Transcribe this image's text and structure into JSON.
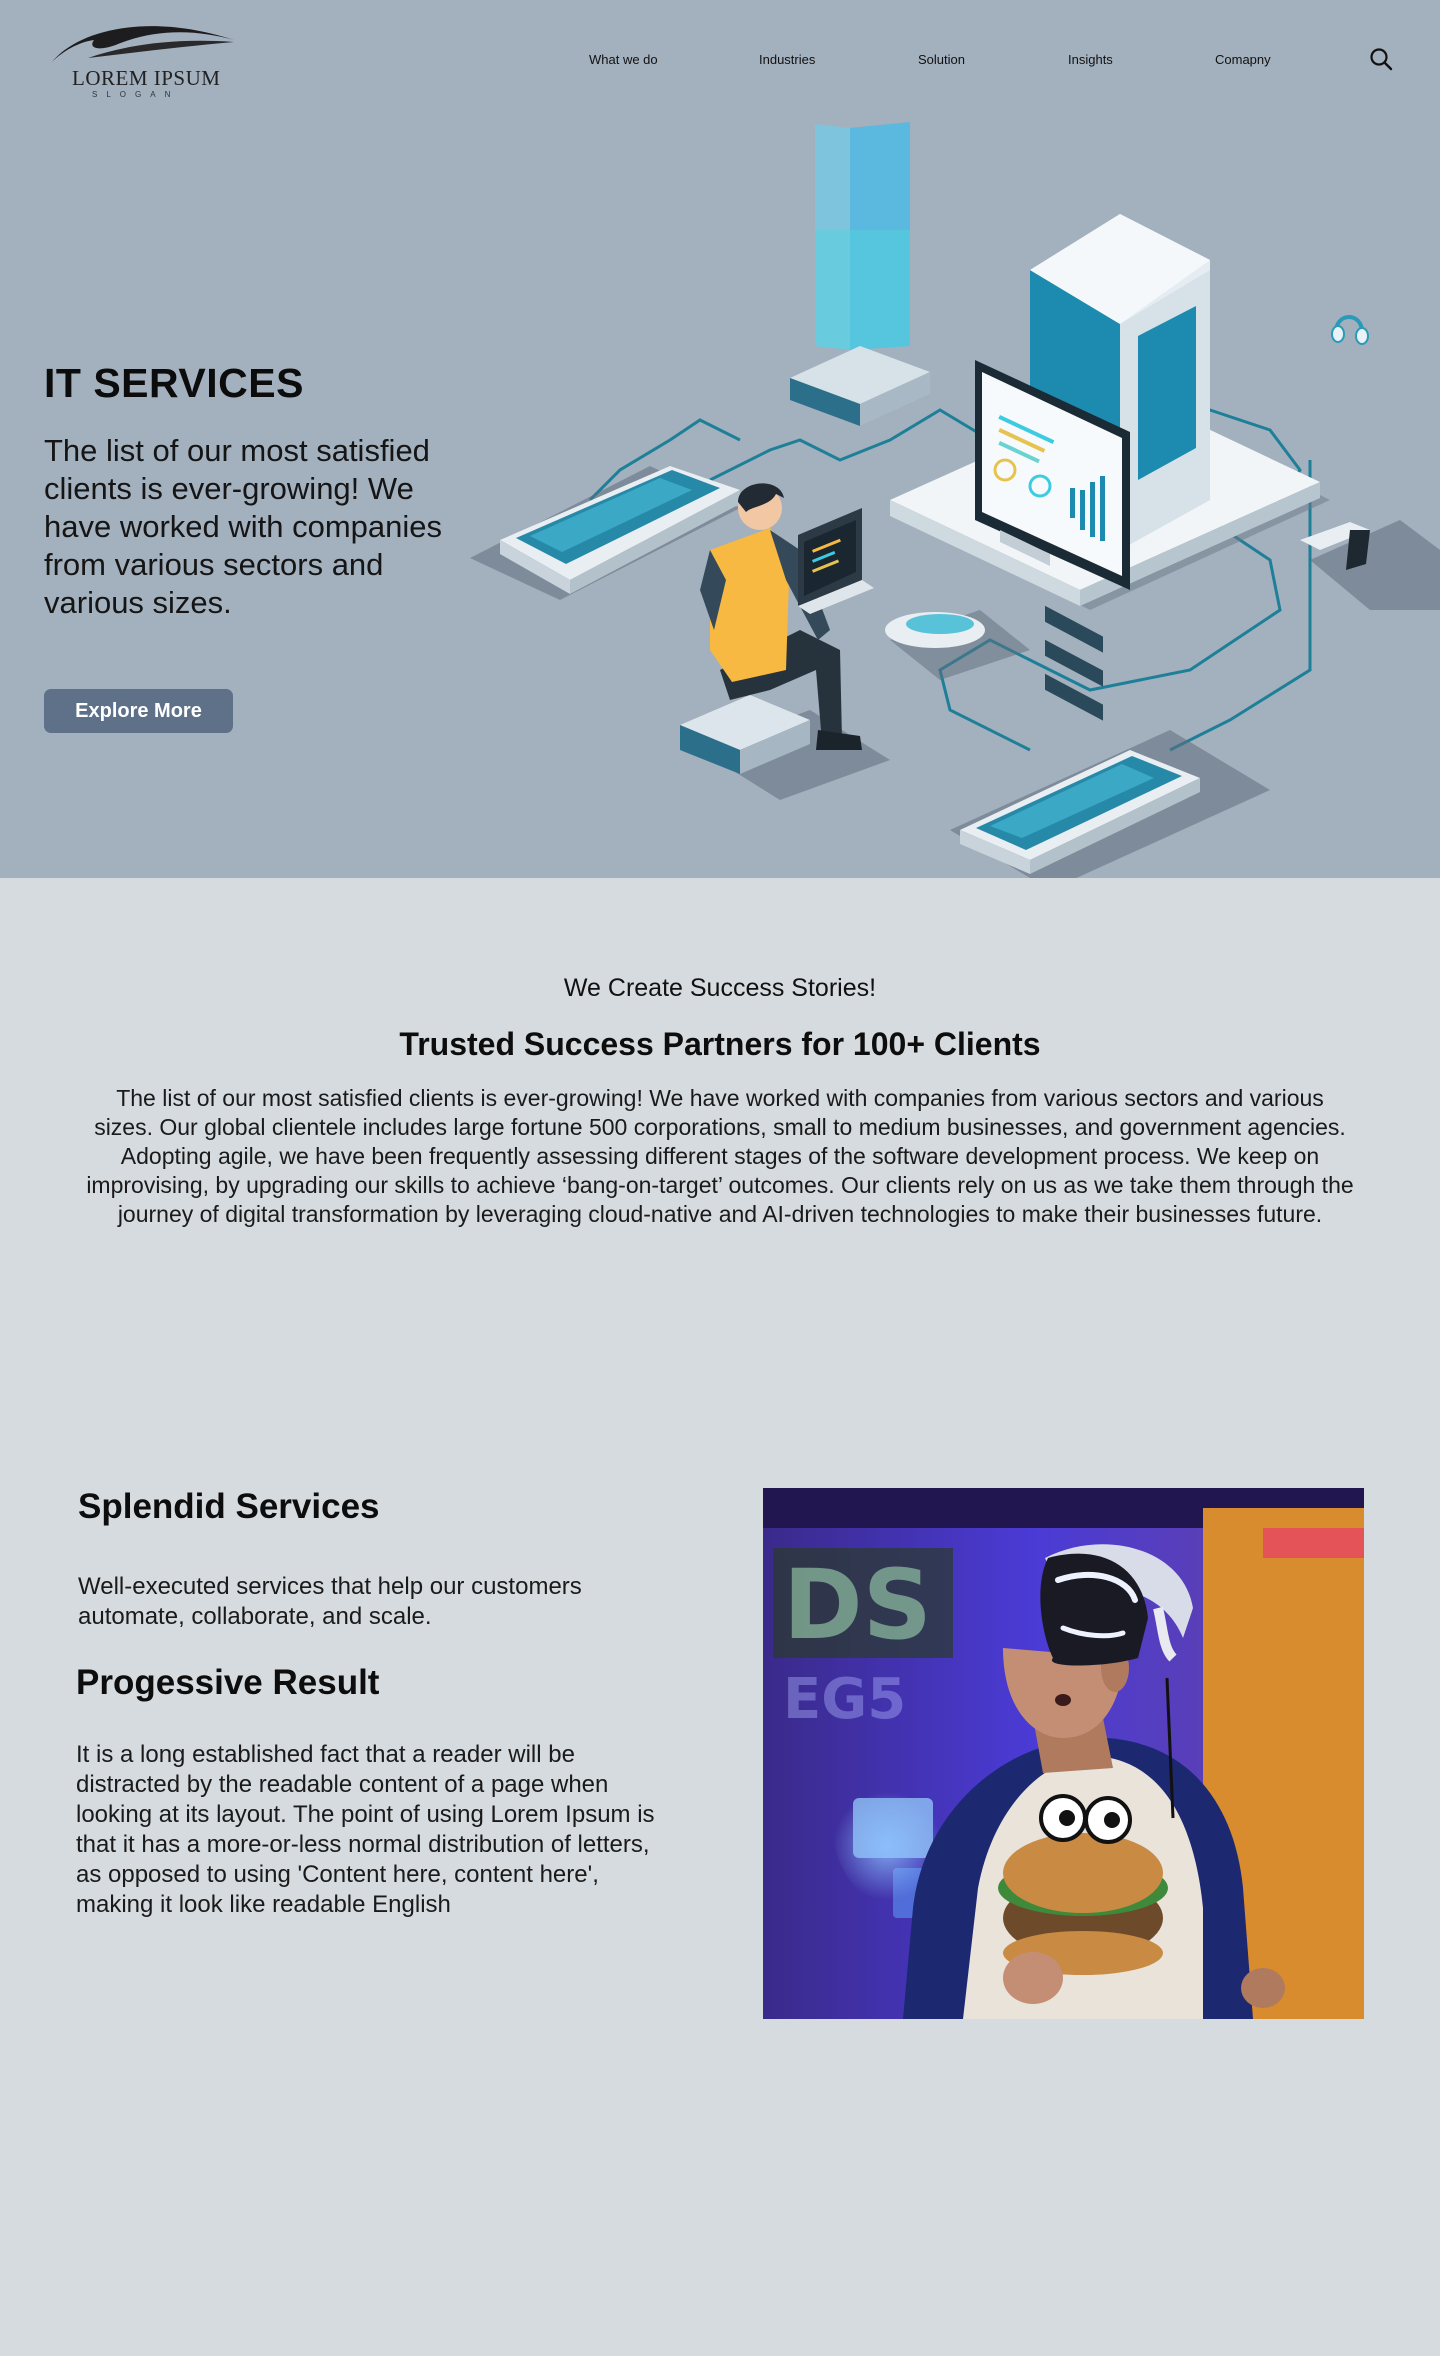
{
  "nav": {
    "logo_name": "LOREM IPSUM",
    "logo_slogan": "SLOGAN",
    "links": [
      "What we do",
      "Industries",
      "Solution",
      "Insights",
      "Comapny"
    ],
    "search_icon": "search-icon"
  },
  "hero": {
    "title": "IT SERVICES",
    "text": "The list of our most satisfied clients is ever-growing! We have worked with companies from various sectors and various sizes.",
    "button": "Explore More"
  },
  "stories": {
    "kicker": "We Create Success Stories!",
    "title": "Trusted Success Partners for 100+ Clients",
    "body": "The list of our most satisfied clients is ever-growing! We have worked with companies from various sectors and various sizes. Our global clientele includes large fortune 500 corporations, small to medium businesses, and government agencies. Adopting agile, we have been frequently assessing different stages of the software development process. We keep on improvising, by upgrading our skills to achieve ‘bang-on-target’ outcomes. Our clients rely on us as we take them through the journey of digital transformation by leveraging cloud-native and AI-driven technologies to make their businesses future."
  },
  "services": {
    "title": "Splendid Services",
    "text": "Well-executed services that help our customers automate, collaborate, and scale."
  },
  "results": {
    "title": "Progessive Result",
    "text": "It is a long established fact that a reader will be distracted by the readable content of a page when looking at its layout. The point of using Lorem Ipsum is that it has a more-or-less normal distribution of letters, as opposed to using 'Content here, content here', making it look like readable English"
  },
  "colors": {
    "hero_bg": "#a3b0bd",
    "page_bg": "#d6dbdf",
    "button_bg": "#5e7189",
    "accent_teal": "#2a9ab8"
  }
}
